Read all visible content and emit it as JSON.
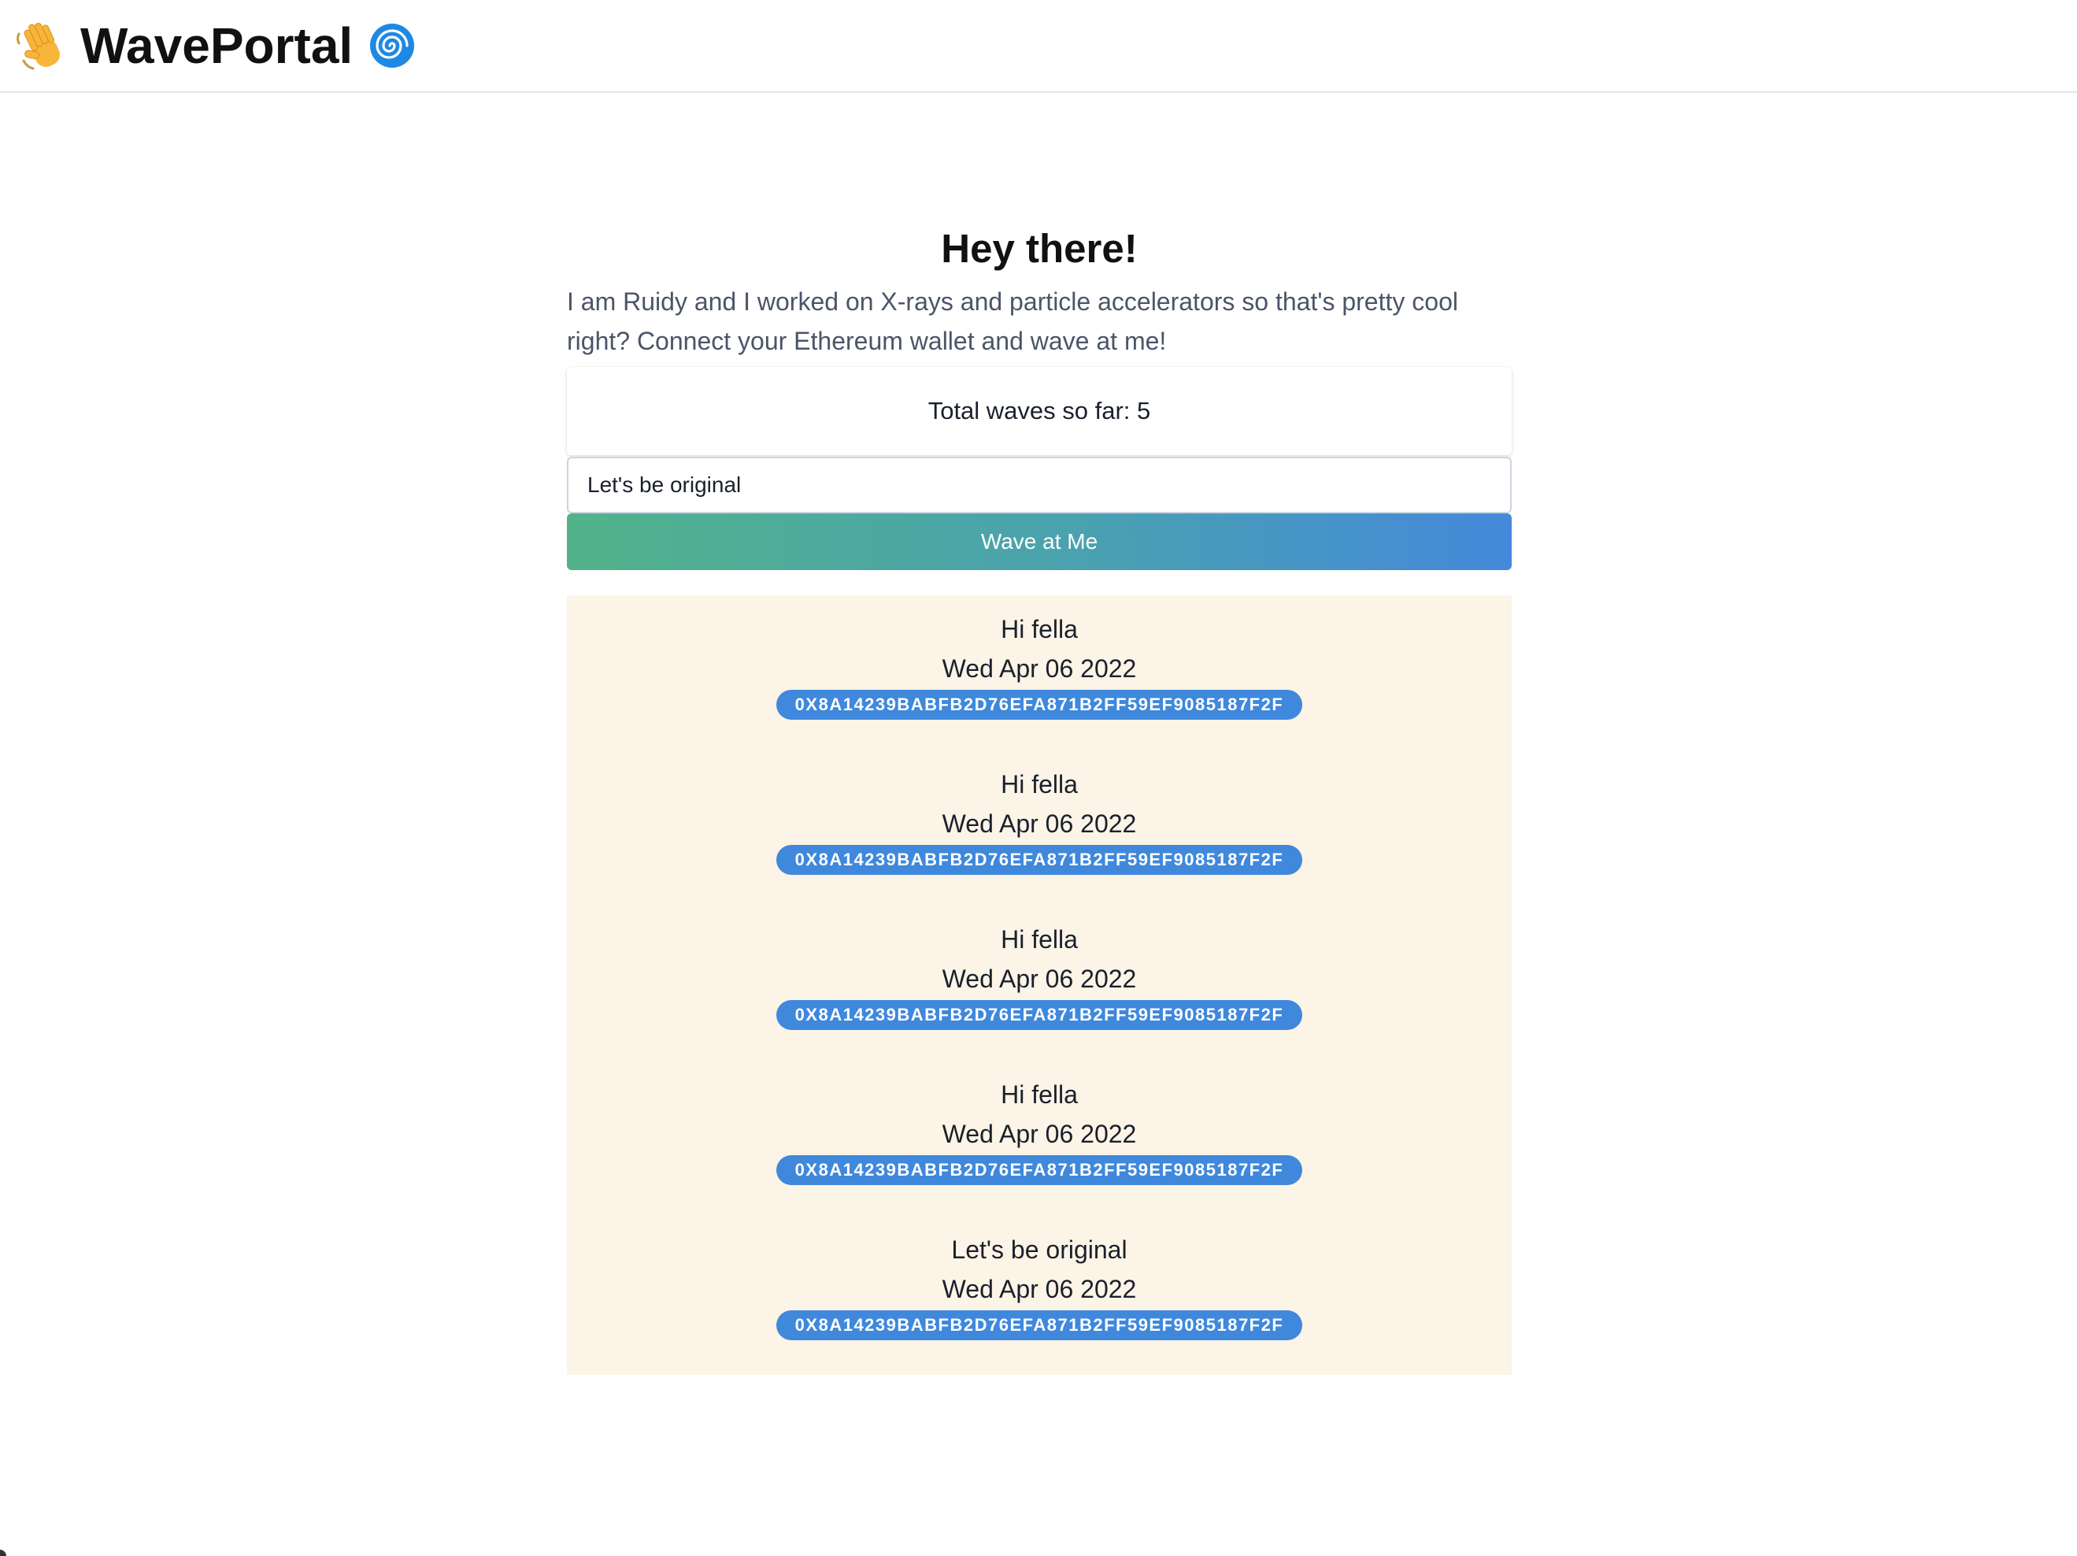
{
  "header": {
    "brand": "WavePortal",
    "left_icon": "waving-hand-icon",
    "right_icon": "swirl-icon"
  },
  "main": {
    "title": "Hey there!",
    "bio": "I am Ruidy and I worked on X-rays and particle accelerators so that's pretty cool right? Connect your Ethereum wallet and wave at me!",
    "total_waves": "Total waves so far: 5",
    "message_input_value": "Let's be original",
    "wave_button_label": "Wave at Me"
  },
  "waves": [
    {
      "message": "Hi fella",
      "date": "Wed Apr 06 2022",
      "address": "0X8A14239BABFB2D76EFA871B2FF59EF9085187F2F"
    },
    {
      "message": "Hi fella",
      "date": "Wed Apr 06 2022",
      "address": "0X8A14239BABFB2D76EFA871B2FF59EF9085187F2F"
    },
    {
      "message": "Hi fella",
      "date": "Wed Apr 06 2022",
      "address": "0X8A14239BABFB2D76EFA871B2FF59EF9085187F2F"
    },
    {
      "message": "Hi fella",
      "date": "Wed Apr 06 2022",
      "address": "0X8A14239BABFB2D76EFA871B2FF59EF9085187F2F"
    },
    {
      "message": "Let's be original",
      "date": "Wed Apr 06 2022",
      "address": "0X8A14239BABFB2D76EFA871B2FF59EF9085187F2F"
    }
  ],
  "colors": {
    "accent_blue": "#3f88dc",
    "gradient_start": "#52b38a",
    "gradient_end": "#4489db",
    "wave_list_bg": "#fcf4e6"
  }
}
